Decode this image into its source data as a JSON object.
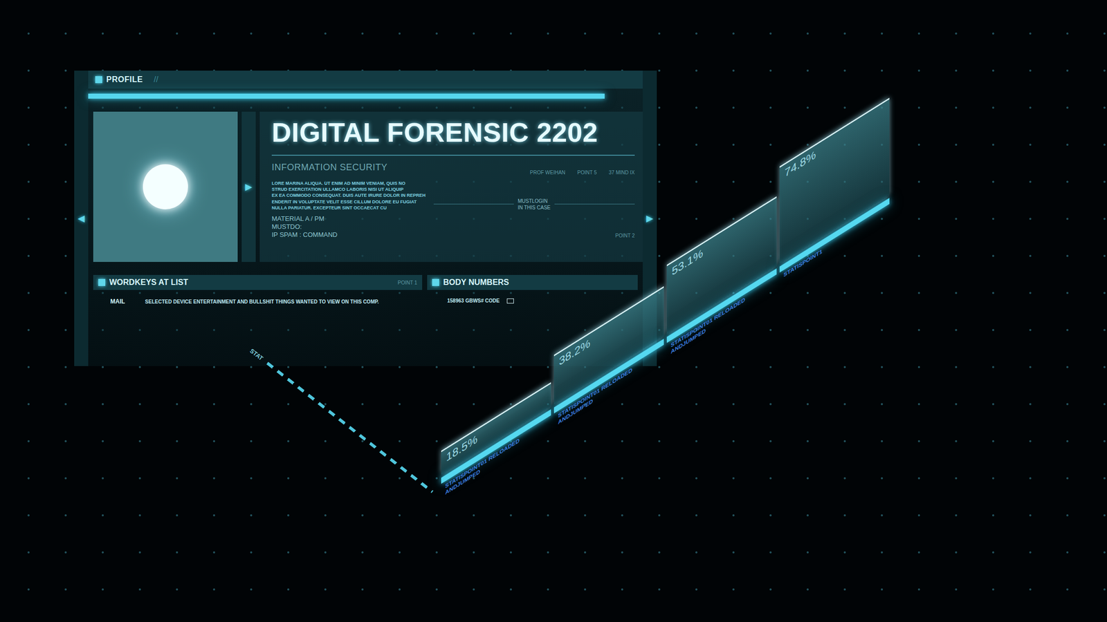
{
  "arrows": {
    "left": "◀",
    "inner": "▶",
    "right": "▶"
  },
  "profile": {
    "header": "PROFILE",
    "header_mark": "//",
    "title": "DIGITAL FORENSIC 2202",
    "subtitle": "INFORMATION SECURITY",
    "meta": [
      "PROF WEIHAN",
      "POINT 5",
      "37 MIND IX"
    ],
    "body_lines": [
      "LORE MARINA ALIQUA. UT ENIM AD MINIM VENIAM, QUIS NO",
      "STRUD EXERCITATION ULLAMCO LABORIS NISI UT ALIQUIP",
      "EX EA COMMODO CONSEQUAT. DUIS AUTE IRURE DOLOR IN REPREH",
      "ENDERIT IN VOLUPTATE VELIT ESSE CILLUM DOLORE EU FUGIAT",
      "NULLA PARIATUR. EXCEPTEUR SINT OCCAECAT CU"
    ],
    "note_lines": [
      "MUSTLOGIN",
      "IN THIS CASE"
    ],
    "material_lines": [
      "MATERIAL A / PM",
      "MUSTDO:",
      "IP SPAM : COMMAND"
    ],
    "point": "POINT 2"
  },
  "wordkeys": {
    "title": "WORDKEYS AT LIST",
    "point": "POINT 1",
    "rows": [
      {
        "label": "MAIL",
        "text": "SELECTED DEVICE ENTERTAINMENT AND BULLSHIT THINGS WANTED TO VIEW ON THIS COMP."
      }
    ]
  },
  "body_numbers": {
    "title": "BODY NUMBERS",
    "code": "158963 GBWS# CODE"
  },
  "chart": {
    "axis_label": "STAT",
    "values": [
      18.5,
      38.2,
      53.1,
      74.8
    ],
    "labels": [
      "18.5%",
      "38.2%",
      "53.1%",
      "74.8%"
    ],
    "captions": [
      [
        "STATISPOINT01 RELOADED",
        "ANDJUMPED"
      ],
      [
        "STATISPOINT01 RELOADED",
        "ANDJUMPED"
      ],
      [
        "STATISPOINT01 RELOADED",
        "ANDJUMPED"
      ],
      [
        "STATISPOINT1"
      ]
    ]
  }
}
